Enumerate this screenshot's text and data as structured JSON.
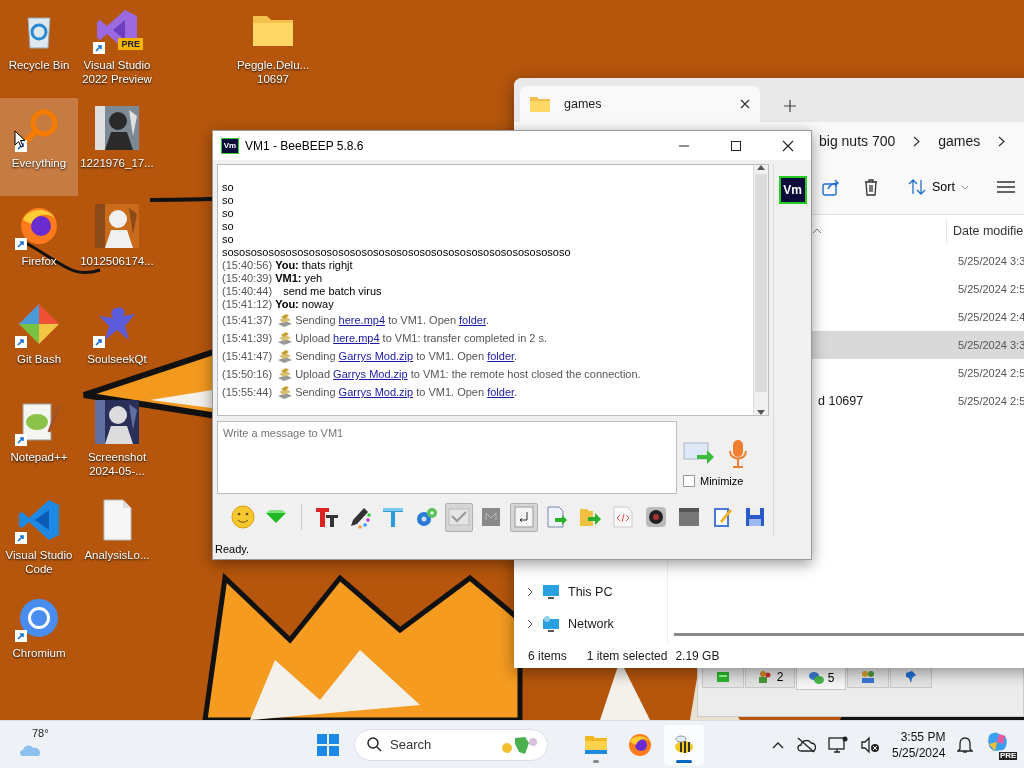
{
  "desktop": {
    "columns": [
      {
        "icons": [
          {
            "label": "Recycle Bin",
            "kind": "recycle",
            "shortcut": false,
            "selected": false
          },
          {
            "label": "Everything",
            "kind": "everything",
            "shortcut": true,
            "selected": true
          },
          {
            "label": "Firefox",
            "kind": "firefox",
            "shortcut": true,
            "selected": false
          },
          {
            "label": "Git Bash",
            "kind": "gitbash",
            "shortcut": true,
            "selected": false
          },
          {
            "label": "Notepad++",
            "kind": "notepad",
            "shortcut": true,
            "selected": false
          },
          {
            "label": "Visual Studio Code",
            "kind": "vscode",
            "shortcut": true,
            "selected": false
          },
          {
            "label": "Chromium",
            "kind": "chromium",
            "shortcut": true,
            "selected": false
          }
        ]
      },
      {
        "icons": [
          {
            "label": "Visual Studio 2022 Preview",
            "kind": "vs",
            "badge": "PRE",
            "shortcut": true,
            "selected": false
          },
          {
            "label": "1221976_17...",
            "kind": "picture",
            "shortcut": false,
            "selected": false
          },
          {
            "label": "1012506174...",
            "kind": "picture",
            "shortcut": false,
            "selected": false
          },
          {
            "label": "SoulseekQt",
            "kind": "soulseek",
            "shortcut": true,
            "selected": false
          },
          {
            "label": "Screenshot 2024-05-...",
            "kind": "picture",
            "shortcut": false,
            "selected": false
          },
          {
            "label": "AnalysisLo...",
            "kind": "file",
            "shortcut": false,
            "selected": false
          }
        ]
      },
      {
        "icons": [
          {
            "label": "Peggle.Delu... 10697",
            "kind": "folder",
            "shortcut": false,
            "selected": false
          }
        ]
      }
    ]
  },
  "explorer": {
    "tabs": [
      {
        "label": "games",
        "selected": true
      }
    ],
    "breadcrumb": [
      "big nuts 700",
      "games"
    ],
    "sort_label": "Sort",
    "column_header": "Date modifie",
    "rows": [
      {
        "date": "5/25/2024 3:3",
        "selected": false
      },
      {
        "date": "5/25/2024 2:5",
        "selected": false
      },
      {
        "date": "5/25/2024 2:4",
        "selected": false
      },
      {
        "date": "5/25/2024 3:3",
        "selected": true
      },
      {
        "date": "5/25/2024 2:5",
        "selected": false
      },
      {
        "name": "d 10697",
        "date": "5/25/2024 2:5",
        "selected": false
      }
    ],
    "nav": [
      {
        "label": "This PC",
        "kind": "pc",
        "expanded": false
      },
      {
        "label": "Network",
        "kind": "network",
        "expanded": false
      }
    ],
    "status": [
      "6 items",
      "1 item selected",
      "2.19 GB"
    ]
  },
  "beebeep_main": {
    "tabs": [
      {
        "kind": "home",
        "selected": false
      },
      {
        "kind": "users",
        "count": "2",
        "selected": false
      },
      {
        "kind": "chats",
        "count": "5",
        "selected": true
      },
      {
        "kind": "groups",
        "selected": false
      },
      {
        "kind": "bird",
        "selected": false
      }
    ]
  },
  "chat_window": {
    "app_icon": "Vm",
    "title": "VM1 - BeeBEEP 5.8.6",
    "log": [
      {
        "kind": "plain",
        "text": "so"
      },
      {
        "kind": "plain",
        "text": "so"
      },
      {
        "kind": "plain",
        "text": "so"
      },
      {
        "kind": "plain",
        "text": "so"
      },
      {
        "kind": "plain",
        "text": "so"
      },
      {
        "kind": "plain",
        "text": "sosososososososososososososososososososososososososososososo"
      },
      {
        "kind": "chat",
        "time": "(15:40:56)",
        "sender": "You:",
        "text": "thats righjt"
      },
      {
        "kind": "chat",
        "time": "(15:40:39)",
        "sender": "VM1:",
        "text": "yeh"
      },
      {
        "kind": "continued",
        "time": "(15:40:44)",
        "text": "send me batch virus"
      },
      {
        "kind": "chat",
        "time": "(15:41:12)",
        "sender": "You:",
        "text": "noway"
      },
      {
        "kind": "system",
        "time": "(15:41:37)",
        "parts": [
          {
            "text": "Sending "
          },
          {
            "link": "here.mp4"
          },
          {
            "text": " to VM1. Open "
          },
          {
            "link": "folder"
          },
          {
            "text": "."
          }
        ]
      },
      {
        "kind": "system",
        "time": "(15:41:39)",
        "parts": [
          {
            "text": "Upload "
          },
          {
            "link": "here.mp4"
          },
          {
            "text": " to VM1: transfer completed in 2 s."
          }
        ]
      },
      {
        "kind": "system",
        "time": "(15:41:47)",
        "parts": [
          {
            "text": "Sending "
          },
          {
            "link": "Garrys Mod.zip"
          },
          {
            "text": " to VM1. Open "
          },
          {
            "link": "folder"
          },
          {
            "text": "."
          }
        ]
      },
      {
        "kind": "system",
        "time": "(15:50:16)",
        "parts": [
          {
            "text": "Upload "
          },
          {
            "link": "Garrys Mod.zip"
          },
          {
            "text": " to VM1: the remote host closed the connection."
          }
        ]
      },
      {
        "kind": "system",
        "time": "(15:55:44)",
        "parts": [
          {
            "text": "Sending "
          },
          {
            "link": "Garrys Mod.zip"
          },
          {
            "text": " to VM1. Open "
          },
          {
            "link": "folder"
          },
          {
            "text": "."
          }
        ]
      }
    ],
    "message": {
      "placeholder": "Write a message to VM1"
    },
    "minimize": {
      "label": "Minimize",
      "checked": false
    },
    "avatar": "Vm",
    "toolbar": [
      {
        "kind": "smiley",
        "pressed": false
      },
      {
        "kind": "gem",
        "pressed": false
      },
      {
        "kind": "separator"
      },
      {
        "kind": "font",
        "pressed": false
      },
      {
        "kind": "pen",
        "pressed": false
      },
      {
        "kind": "funnel",
        "pressed": false
      },
      {
        "kind": "gears",
        "pressed": false
      },
      {
        "kind": "tick",
        "pressed": true
      },
      {
        "kind": "book",
        "pressed": false
      },
      {
        "kind": "enter",
        "pressed": true
      },
      {
        "kind": "docarrow",
        "pressed": false
      },
      {
        "kind": "folderarrow",
        "pressed": false
      },
      {
        "kind": "code",
        "pressed": false
      },
      {
        "kind": "camera",
        "pressed": false
      },
      {
        "kind": "window",
        "pressed": false
      },
      {
        "kind": "note",
        "pressed": false
      },
      {
        "kind": "save",
        "pressed": false
      }
    ],
    "status": "Ready."
  },
  "taskbar": {
    "weather": "78°",
    "search": {
      "placeholder": "Search"
    },
    "apps": [
      {
        "kind": "explorer",
        "running": true,
        "active": false
      },
      {
        "kind": "firefox",
        "running": false,
        "active": false
      },
      {
        "kind": "bee",
        "running": true,
        "active": true
      }
    ],
    "time": "3:55 PM",
    "date": "5/25/2024",
    "copilot_badge": "PRE"
  }
}
